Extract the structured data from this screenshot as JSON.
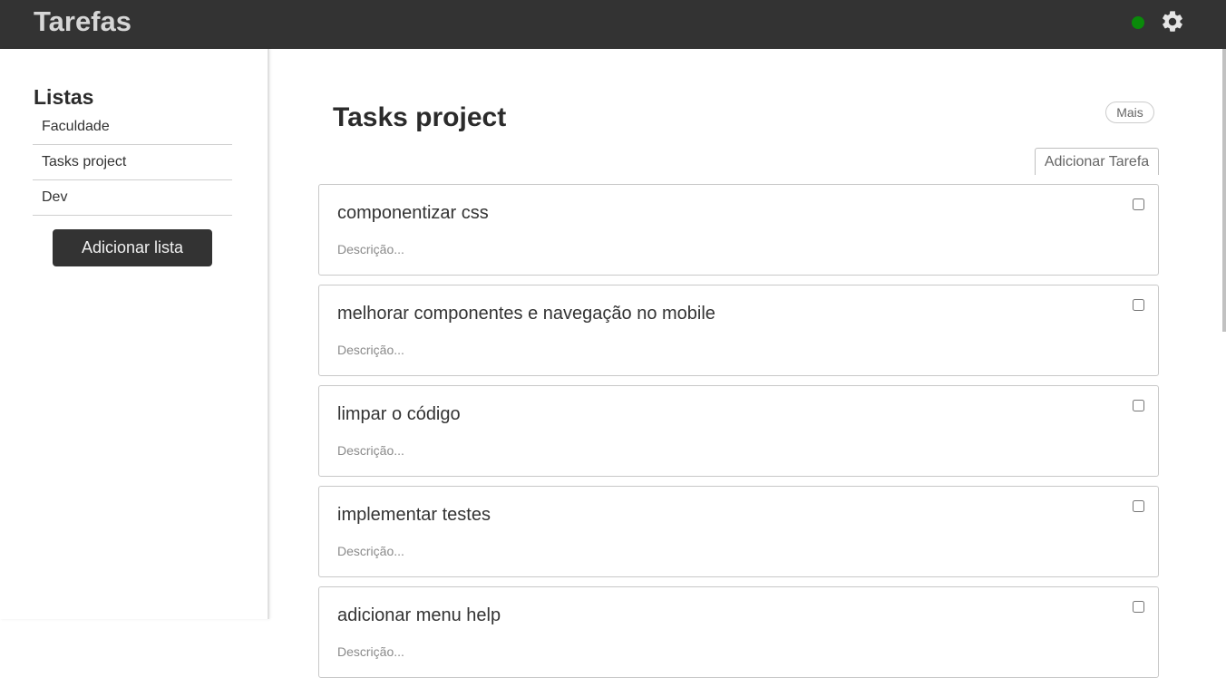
{
  "header": {
    "title": "Tarefas",
    "status_color": "#0a8a0a"
  },
  "sidebar": {
    "title": "Listas",
    "items": [
      {
        "label": "Faculdade"
      },
      {
        "label": "Tasks project"
      },
      {
        "label": "Dev"
      }
    ],
    "add_button_label": "Adicionar lista"
  },
  "main": {
    "title": "Tasks project",
    "more_label": "Mais",
    "add_task_label": "Adicionar Tarefa",
    "tasks": [
      {
        "title": "componentizar css",
        "description": "Descrição...",
        "done": false
      },
      {
        "title": "melhorar componentes e navegação no mobile",
        "description": "Descrição...",
        "done": false
      },
      {
        "title": "limpar o código",
        "description": "Descrição...",
        "done": false
      },
      {
        "title": "implementar testes",
        "description": "Descrição...",
        "done": false
      },
      {
        "title": "adicionar menu help",
        "description": "Descrição...",
        "done": false
      }
    ]
  },
  "icons": {
    "status": "status-dot-icon",
    "settings": "gear-icon"
  },
  "colors": {
    "topbar": "#333333",
    "title_text": "#d6d6d6",
    "button_dark": "#333333"
  }
}
